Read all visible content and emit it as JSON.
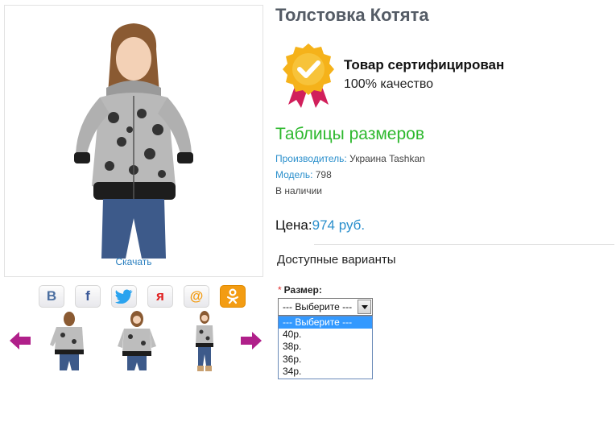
{
  "product": {
    "title": "Толстовка Котята",
    "download_label": "Скачать"
  },
  "certificate": {
    "title": "Товар сертифицирован",
    "subtitle": "100% качество",
    "icon": "certificate-checkmark-ribbon-icon"
  },
  "size_table_link": "Таблицы размеров",
  "meta": {
    "manufacturer_label": "Производитель:",
    "manufacturer_value": "Украина Tashkan",
    "model_label": "Модель:",
    "model_value": "798",
    "stock": "В наличии"
  },
  "price": {
    "label": "Цена:",
    "value": "974 руб."
  },
  "variants": {
    "heading": "Доступные варианты",
    "size_label": "Размер:",
    "required_mark": "*",
    "selected": "--- Выберите ---",
    "options": [
      "--- Выберите ---",
      "40р.",
      "38р.",
      "36р.",
      "34р."
    ]
  },
  "social": [
    {
      "name": "vkontakte",
      "glyph": "В",
      "color": "#4a6ea0"
    },
    {
      "name": "facebook",
      "glyph": "f",
      "color": "#3b5998"
    },
    {
      "name": "twitter",
      "glyph": "",
      "color": "#2aa3ef"
    },
    {
      "name": "yaru",
      "glyph": "я",
      "color": "#e02020"
    },
    {
      "name": "mailru",
      "glyph": "@",
      "color": "#f39c12"
    },
    {
      "name": "odnoklassniki",
      "glyph": "ок",
      "color": "#f39c12"
    }
  ],
  "colors": {
    "link": "#2a8fcc",
    "accent_green": "#2db82d",
    "arrow": "#b0208a"
  }
}
